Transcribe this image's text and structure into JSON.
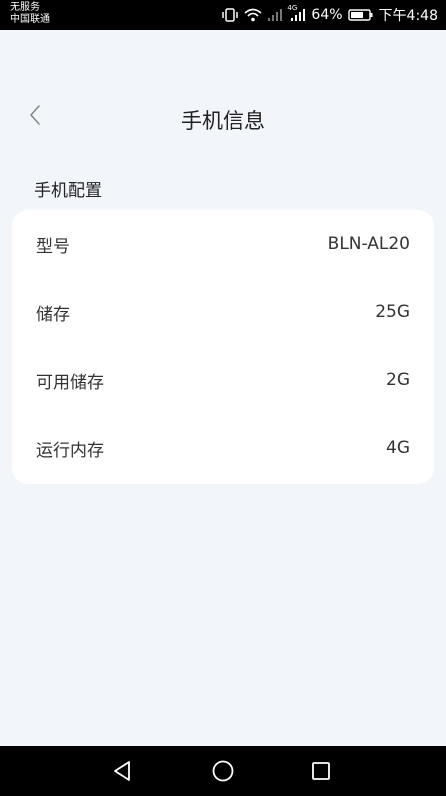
{
  "status_bar": {
    "carrier_line1": "无服务",
    "carrier_line2": "中国联通",
    "network_label": "4G",
    "battery_percent": "64%",
    "time": "下午4:48"
  },
  "header": {
    "title": "手机信息"
  },
  "section": {
    "title": "手机配置"
  },
  "rows": [
    {
      "label": "型号",
      "value": "BLN-AL20"
    },
    {
      "label": "储存",
      "value": "25G"
    },
    {
      "label": "可用储存",
      "value": "2G"
    },
    {
      "label": "运行内存",
      "value": "4G"
    }
  ],
  "icons": {
    "back": "chevron-left-icon",
    "nav_back": "triangle-back-icon",
    "nav_home": "circle-home-icon",
    "nav_recent": "square-recent-icon"
  }
}
